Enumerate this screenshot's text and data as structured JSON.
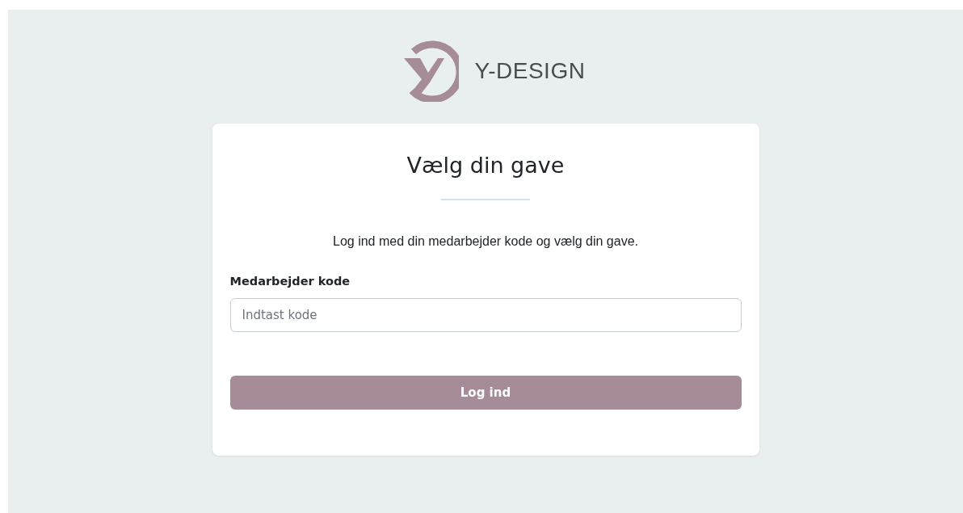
{
  "brand": {
    "name": "Y-DESIGN"
  },
  "card": {
    "title": "Vælg din gave",
    "intro": "Log ind med din medarbejder kode og vælg din gave.",
    "field": {
      "label": "Medarbejder kode",
      "placeholder": "Indtast kode"
    },
    "button": "Log ind"
  }
}
